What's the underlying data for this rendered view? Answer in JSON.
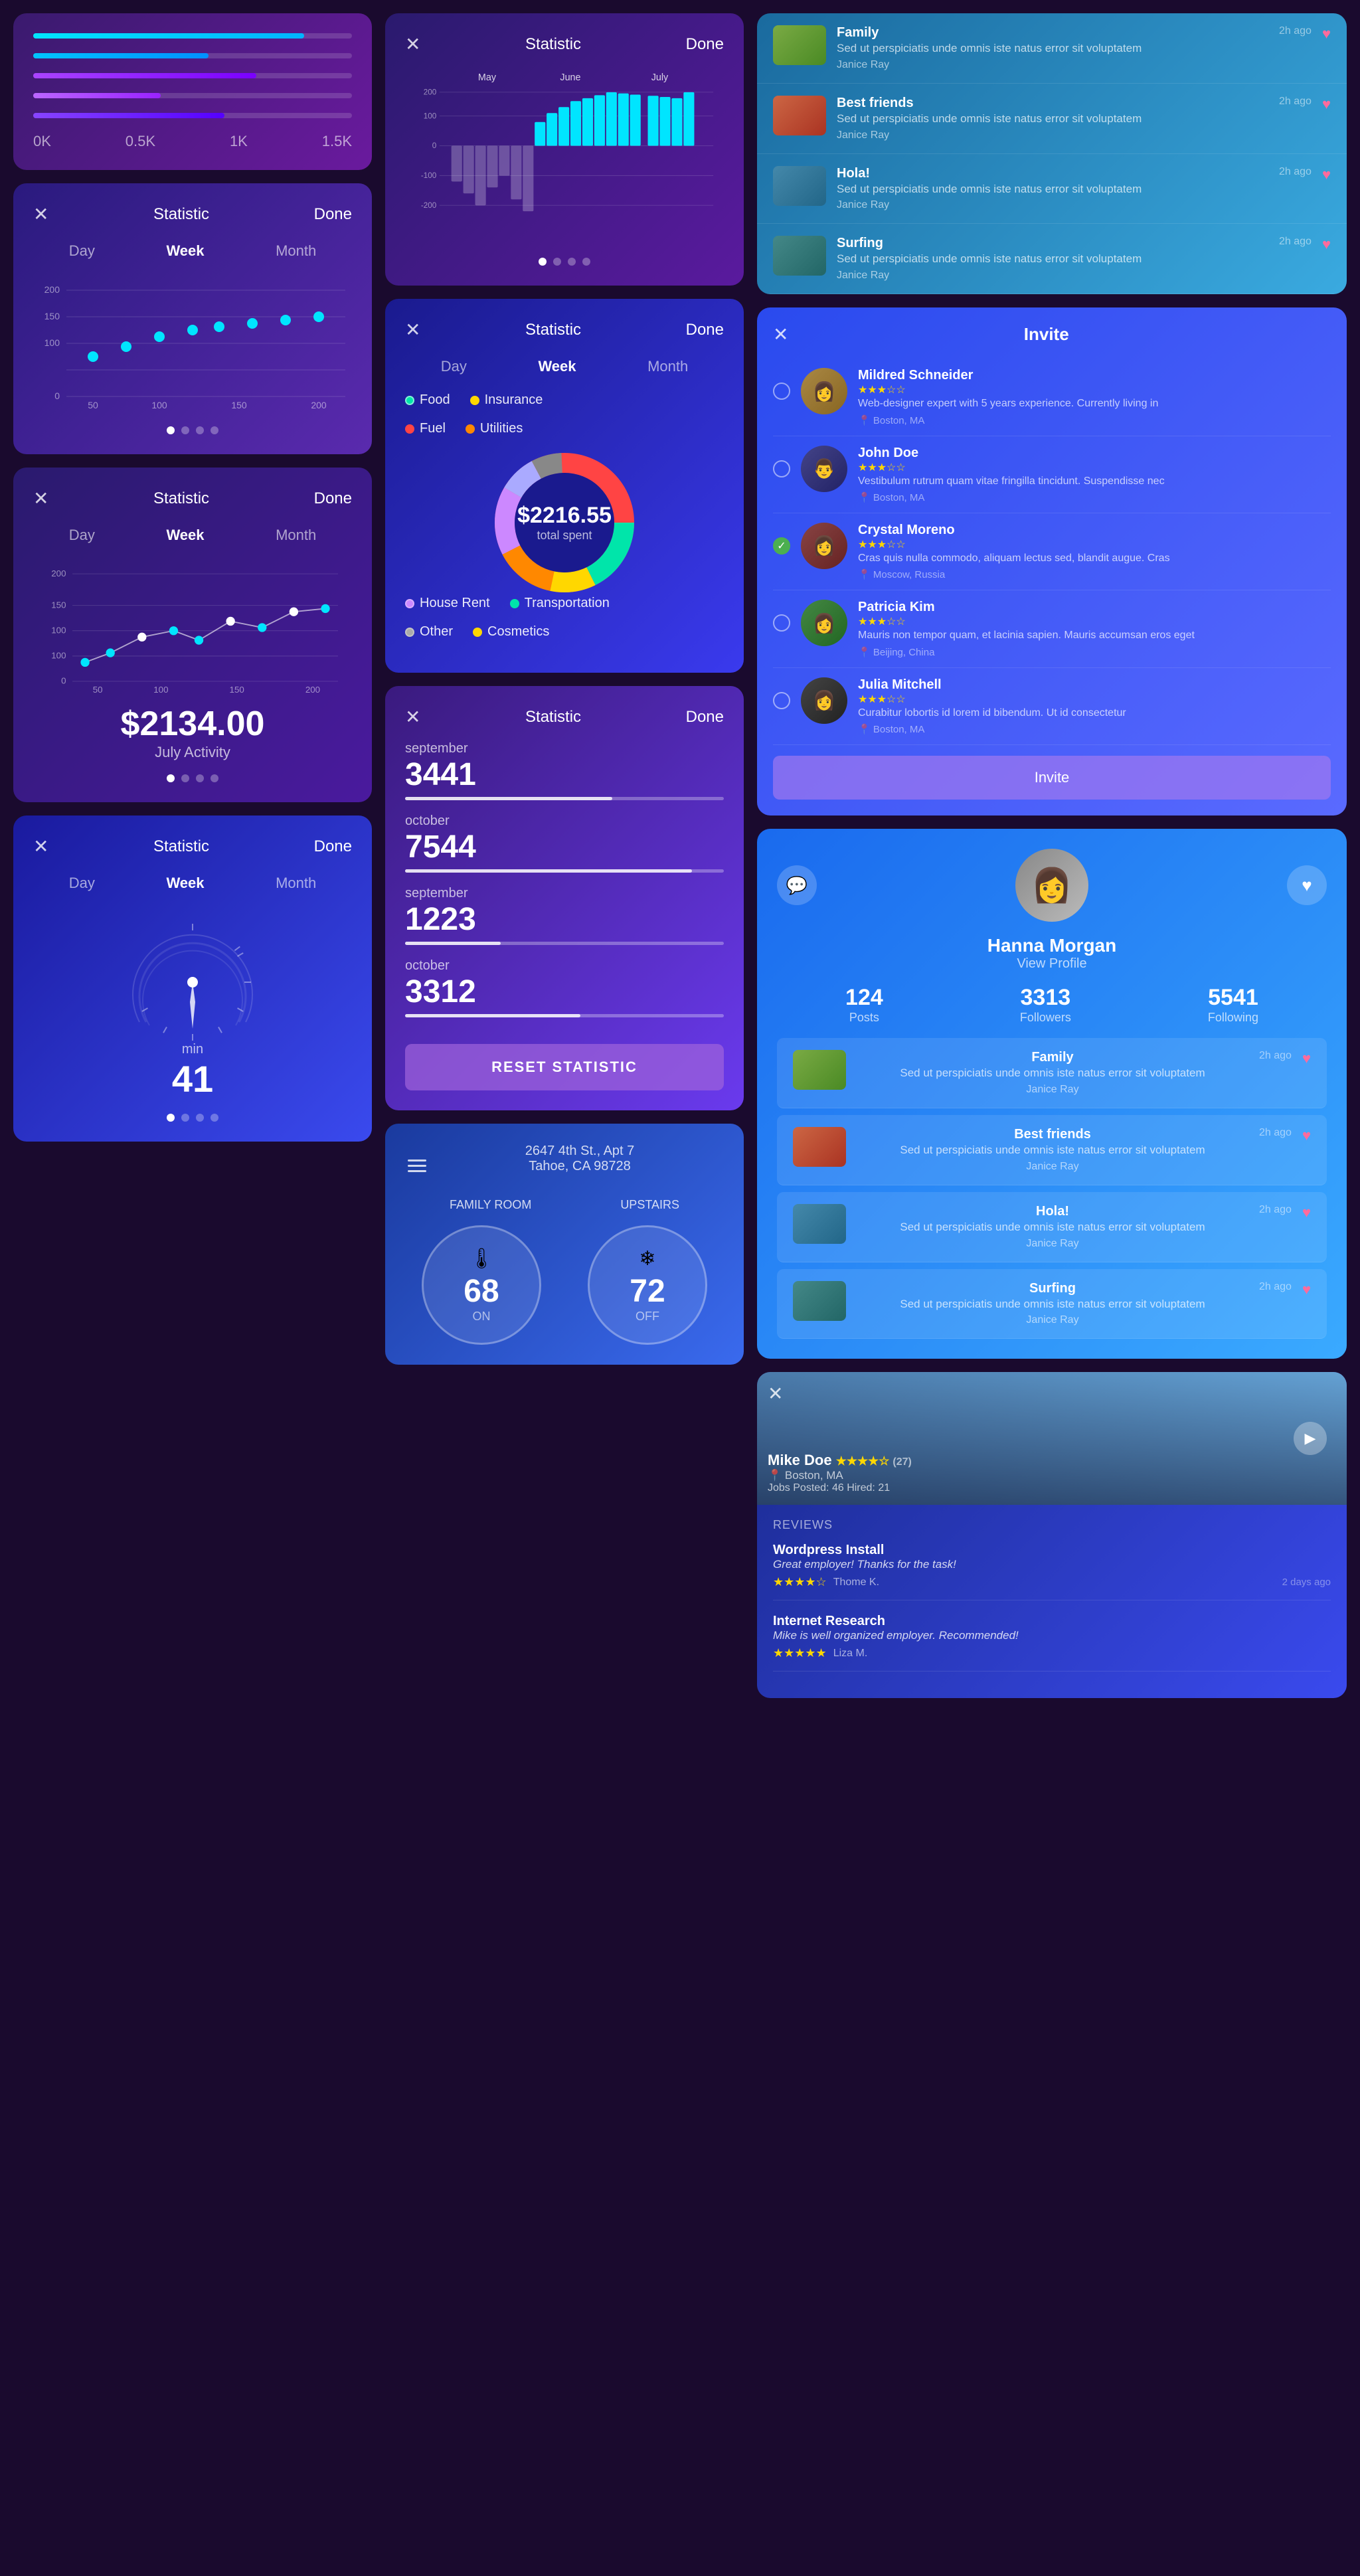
{
  "left": {
    "progress_card": {
      "bars": [
        {
          "fill": 85,
          "color": "#00e5ff"
        },
        {
          "fill": 55,
          "color": "#00b4ff"
        },
        {
          "fill": 70,
          "color": "#7a4aff"
        },
        {
          "fill": 40,
          "color": "#aa44ff"
        },
        {
          "fill": 60,
          "color": "#6644ff"
        }
      ],
      "x_labels": [
        "0K",
        "0.5K",
        "1K",
        "1.5K"
      ]
    },
    "stat_card_1": {
      "title": "Statistic",
      "done": "Done",
      "tabs": [
        "Day",
        "Week",
        "Month"
      ],
      "active_tab": "Week",
      "y_labels": [
        "200",
        "150",
        "100",
        "0"
      ],
      "x_labels": [
        "50",
        "100",
        "150",
        "200"
      ],
      "dots_count": 4
    },
    "stat_card_2": {
      "title": "Statistic",
      "done": "Done",
      "tabs": [
        "Day",
        "Week",
        "Month"
      ],
      "active_tab": "Week",
      "y_labels": [
        "200",
        "150",
        "100",
        "100",
        "0"
      ],
      "x_labels": [
        "50",
        "100",
        "150",
        "200"
      ],
      "amount": "$2134.00",
      "amount_label": "July Activity",
      "dots_count": 4
    },
    "gauge_card": {
      "title": "Statistic",
      "done": "Done",
      "tabs": [
        "Day",
        "Week",
        "Month"
      ],
      "active_tab": "Week",
      "min_label": "min",
      "value": "41",
      "dots_count": 4
    }
  },
  "center": {
    "bar_chart_card": {
      "title": "Statistic",
      "done": "Done",
      "months": [
        "May",
        "June",
        "July"
      ],
      "y_labels": [
        "200",
        "100",
        "0",
        "-100",
        "-200"
      ],
      "dots_count": 4
    },
    "donut_card": {
      "title": "Statistic",
      "done": "Done",
      "tabs": [
        "Day",
        "Week",
        "Month"
      ],
      "active_tab": "Week",
      "legend": [
        {
          "label": "Food",
          "color": "#00e5aa"
        },
        {
          "label": "Insurance",
          "color": "#FFD700"
        },
        {
          "label": "Fuel",
          "color": "#ff4444"
        },
        {
          "label": "Utilities",
          "color": "#ff8800"
        }
      ],
      "legend2": [
        {
          "label": "House Rent",
          "color": "#cc88ff"
        },
        {
          "label": "Transportation",
          "color": "#00e5aa"
        },
        {
          "label": "Other",
          "color": "#aaaaaa"
        },
        {
          "label": "Cosmetics",
          "color": "#FFD700"
        }
      ],
      "amount": "$2216.55",
      "amount_sub": "total spent"
    },
    "stats_list_card": {
      "title": "Statistic",
      "done": "Done",
      "items": [
        {
          "period": "september",
          "value": "3441",
          "fill_pct": 65
        },
        {
          "period": "october",
          "value": "7544",
          "fill_pct": 90
        },
        {
          "period": "september",
          "value": "1223",
          "fill_pct": 30
        },
        {
          "period": "october",
          "value": "3312",
          "fill_pct": 55
        }
      ],
      "reset_btn": "RESET STATISTIC"
    },
    "thermo_card": {
      "address": "2647 4th St., Apt 7\nTahoe, CA 98728",
      "room1": "FAMILY ROOM",
      "room2": "UPSTAIRS",
      "dial1_value": "68",
      "dial1_state": "ON",
      "dial2_value": "72",
      "dial2_state": "OFF",
      "dial1_icon": "🌡",
      "dial2_icon": "❄"
    }
  },
  "right": {
    "social_top": {
      "items": [
        {
          "title": "Family",
          "desc": "Sed ut perspiciatis unde omnis iste natus error sit voluptatem",
          "author": "Janice Ray",
          "time": "2h ago",
          "liked": false
        },
        {
          "title": "Best friends",
          "desc": "Sed ut perspiciatis unde omnis iste natus error sit voluptatem",
          "author": "Janice Ray",
          "time": "2h ago",
          "liked": true
        },
        {
          "title": "Hola!",
          "desc": "Sed ut perspiciatis unde omnis iste natus error sit voluptatem",
          "author": "Janice Ray",
          "time": "2h ago",
          "liked": true
        },
        {
          "title": "Surfing",
          "desc": "Sed ut perspiciatis unde omnis iste natus error sit voluptatem",
          "author": "Janice Ray",
          "time": "2h ago",
          "liked": true
        }
      ]
    },
    "invite_card": {
      "title": "Invite",
      "persons": [
        {
          "name": "Mildred Schneider",
          "desc": "Web-designer expert with 5 years experience. Currently living in",
          "location": "Boston, MA",
          "stars": 3,
          "selected": false
        },
        {
          "name": "John Doe",
          "desc": "Vestibulum rutrum quam vitae fringilla tincidunt. Suspendisse nec",
          "location": "Boston, MA",
          "stars": 3,
          "selected": false
        },
        {
          "name": "Crystal Moreno",
          "desc": "Cras quis nulla commodo, aliquam lectus sed, blandit augue. Cras",
          "location": "Moscow, Russia",
          "stars": 3,
          "selected": true
        },
        {
          "name": "Patricia Kim",
          "desc": "Mauris non tempor quam, et lacinia sapien. Mauris accumsan eros eget",
          "location": "Beijing, China",
          "stars": 3,
          "selected": false
        },
        {
          "name": "Julia Mitchell",
          "desc": "Curabitur lobortis id lorem id bibendum. Ut id consectetur",
          "location": "Boston, MA",
          "stars": 3,
          "selected": false
        }
      ],
      "invite_btn": "Invite"
    },
    "profile_card": {
      "name": "Hanna Morgan",
      "view_profile": "View Profile",
      "posts": "124",
      "posts_label": "Posts",
      "followers": "3313",
      "followers_label": "Followers",
      "following": "5541",
      "following_label": "Following",
      "social_items": [
        {
          "title": "Family",
          "desc": "Sed ut perspiciatis unde omnis iste natus error sit voluptatem",
          "author": "Janice Ray",
          "time": "2h ago"
        },
        {
          "title": "Best friends",
          "desc": "Sed ut perspiciatis unde omnis iste natus error sit voluptatem",
          "author": "Janice Ray",
          "time": "2h ago"
        },
        {
          "title": "Hola!",
          "desc": "Sed ut perspiciatis unde omnis iste natus error sit voluptatem",
          "author": "Janice Ray",
          "time": "2h ago"
        },
        {
          "title": "Surfing",
          "desc": "Sed ut perspiciatis unde omnis iste natus error sit voluptatem",
          "author": "Janice Ray",
          "time": "2h ago"
        }
      ]
    },
    "review_card": {
      "hero_name": "Mike Doe",
      "hero_stars": 4,
      "hero_star_count": "(27)",
      "hero_location": "Boston, MA",
      "hero_jobs": "Jobs Posted: 46  Hired: 21",
      "reviews_label": "REVIEWS",
      "reviews": [
        {
          "job_title": "Wordpress Install",
          "quote": "Great employer! Thanks for the task!",
          "stars": 4,
          "reviewer": "Thome K.",
          "time": "2 days ago"
        },
        {
          "job_title": "Internet Research",
          "quote": "Mike is well organized employer. Recommended!",
          "stars": 5,
          "reviewer": "Liza M.",
          "time": ""
        }
      ]
    }
  }
}
